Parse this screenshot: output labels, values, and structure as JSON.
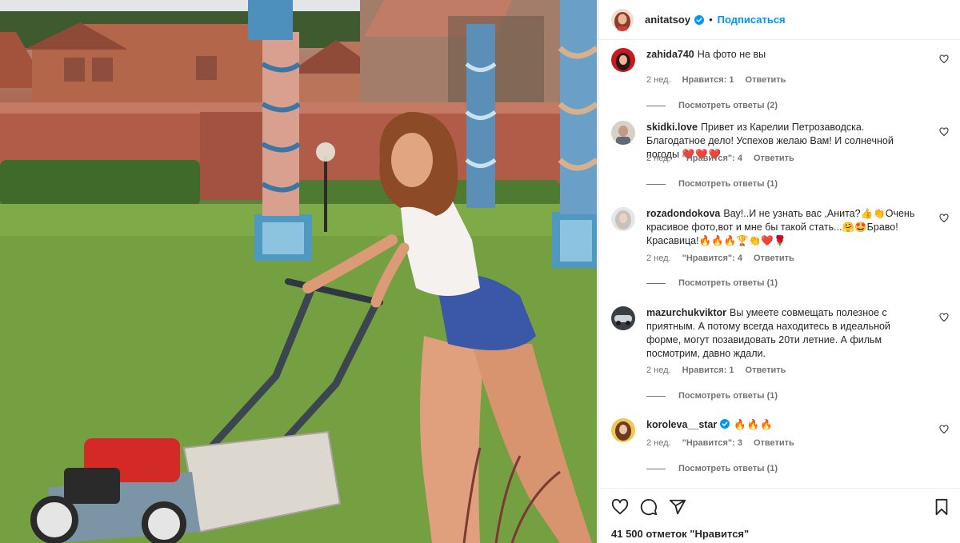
{
  "post": {
    "author": "anitatsoy",
    "dot": "•",
    "follow_label": "Подписаться",
    "likes_text": "41 500 отметок \"Нравится\""
  },
  "colors": {
    "accent": "#0095f6",
    "secondary_text": "#737373",
    "primary_text": "#262626",
    "heart_emoji": "#e0245e"
  },
  "comments": [
    {
      "username": "zahida740",
      "text": "На фото не вы",
      "emoji": "",
      "verified": false,
      "time": "2 нед.",
      "likes": "Нравится: 1",
      "reply": "Ответить",
      "view_replies": "Посмотреть ответы (2)"
    },
    {
      "username": "skidki.love",
      "text": "Привет из Карелии Петрозаводска. Благодатное дело! Успехов желаю Вам! И солнечной погоды",
      "emoji": "❤️❤️❤️",
      "verified": false,
      "time": "2 нед.",
      "likes": "\"Нравится\": 4",
      "reply": "Ответить",
      "view_replies": "Посмотреть ответы (1)"
    },
    {
      "username": "rozadondokova",
      "text": "Вау!..И не узнать вас ,Анита?👍👏Очень красивое фото,вот и мне бы такой стать...🤗🤩Браво! Красавица!🔥🔥🔥🏆👏❤️🌹",
      "emoji": "",
      "verified": false,
      "time": "2 нед.",
      "likes": "\"Нравится\": 4",
      "reply": "Ответить",
      "view_replies": "Посмотреть ответы (1)"
    },
    {
      "username": "mazurchukviktor",
      "text": "Вы умеете совмещать полезное с приятным. А потому всегда находитесь в идеальной форме, могут позавидовать 20ти летние. А фильм посмотрим, давно ждали.",
      "emoji": "",
      "verified": false,
      "time": "2 нед.",
      "likes": "Нравится: 1",
      "reply": "Ответить",
      "view_replies": "Посмотреть ответы (1)"
    },
    {
      "username": "koroleva__star",
      "text": "",
      "emoji": "🔥🔥🔥",
      "verified": true,
      "time": "2 нед.",
      "likes": "\"Нравится\": 3",
      "reply": "Ответить",
      "view_replies": "Посмотреть ответы (1)"
    }
  ],
  "icons": {
    "like": "heart-icon",
    "comment": "comment-icon",
    "share": "share-icon",
    "save": "bookmark-icon",
    "verified": "verified-badge-icon"
  }
}
